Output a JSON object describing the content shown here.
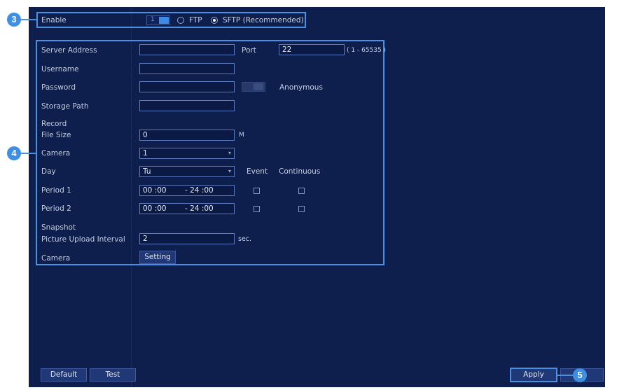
{
  "ftp": {
    "enable_label": "Enable",
    "toggle_text": "1",
    "ftp_option": "FTP",
    "sftp_option": "SFTP (Recommended)"
  },
  "server": {
    "address_label": "Server Address",
    "address_value": "",
    "port_label": "Port",
    "port_value": "22",
    "port_range": "( 1 - 65535 )",
    "username_label": "Username",
    "username_value": "",
    "password_label": "Password",
    "password_value": "",
    "anonymous_label": "Anonymous",
    "storage_path_label": "Storage Path",
    "storage_path_value": ""
  },
  "record": {
    "section_label": "Record",
    "file_size_label": "File Size",
    "file_size_value": "0",
    "file_size_unit": "M",
    "camera_label": "Camera",
    "camera_value": "1",
    "day_label": "Day",
    "day_value": "Tu",
    "event_label": "Event",
    "continuous_label": "Continuous",
    "period1_label": "Period 1",
    "period1_start": "00 :00",
    "period1_end": "- 24 :00",
    "period2_label": "Period 2",
    "period2_start": "00 :00",
    "period2_end": "- 24 :00"
  },
  "snapshot": {
    "section_label": "Snapshot",
    "interval_label": "Picture Upload Interval",
    "interval_value": "2",
    "interval_unit": "sec.",
    "camera_label": "Camera",
    "setting_button": "Setting"
  },
  "footer": {
    "default_button": "Default",
    "test_button": "Test",
    "apply_button": "Apply"
  },
  "callouts": {
    "c3": "3",
    "c4": "4",
    "c5": "5"
  },
  "colors": {
    "background": "#0e1f4d",
    "accent": "#3e8fe3",
    "field_border": "#5d7cc2"
  }
}
